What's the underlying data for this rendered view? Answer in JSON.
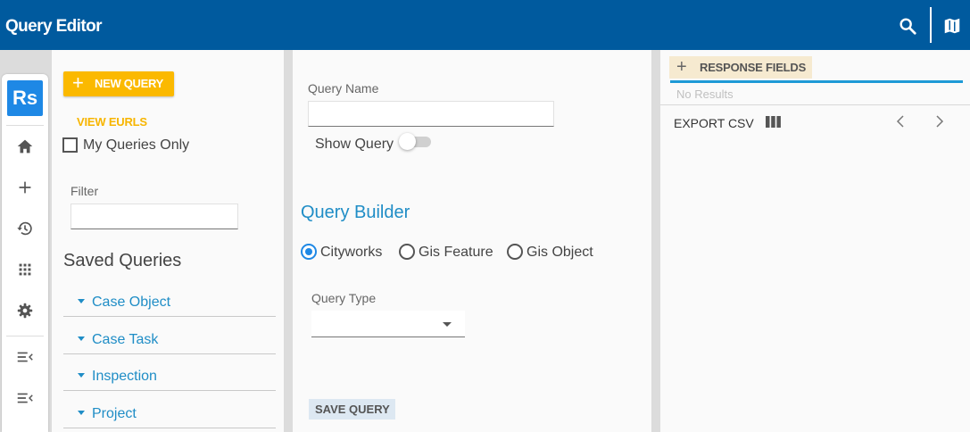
{
  "header": {
    "title": "Query Editor",
    "search_icon": "search-icon",
    "map_icon": "map-icon"
  },
  "rail": {
    "logo": "Rs",
    "items": [
      {
        "icon": "home-icon"
      },
      {
        "icon": "plus-icon"
      },
      {
        "icon": "history-icon"
      },
      {
        "icon": "apps-grid-icon"
      },
      {
        "icon": "gear-icon"
      },
      {
        "icon": "collapse-menu-icon"
      },
      {
        "icon": "collapse-menu-icon"
      }
    ]
  },
  "left_panel": {
    "new_query_label": "NEW QUERY",
    "view_eurls_label": "VIEW EURLS",
    "my_queries_label": "My Queries Only",
    "my_queries_checked": false,
    "filter_label": "Filter",
    "filter_value": "",
    "saved_queries_title": "Saved Queries",
    "groups": [
      {
        "label": "Case Object"
      },
      {
        "label": "Case Task"
      },
      {
        "label": "Inspection"
      },
      {
        "label": "Project"
      }
    ]
  },
  "middle_panel": {
    "query_name_label": "Query Name",
    "query_name_value": "",
    "show_query_label": "Show Query",
    "show_query_on": false,
    "builder_title": "Query Builder",
    "radio_options": [
      {
        "label": "Cityworks",
        "selected": true
      },
      {
        "label": "Gis Feature",
        "selected": false
      },
      {
        "label": "Gis Object",
        "selected": false
      }
    ],
    "query_type_label": "Query Type",
    "query_type_value": "",
    "save_query_label": "SAVE QUERY"
  },
  "right_panel": {
    "response_fields_label": "RESPONSE FIELDS",
    "no_results_text": "No Results",
    "export_csv_label": "EXPORT CSV",
    "columns_icon": "columns-icon",
    "prev_icon": "chevron-left-icon",
    "next_icon": "chevron-right-icon"
  },
  "colors": {
    "header_bg": "#005a9e",
    "accent_yellow": "#fbb900",
    "link_blue": "#1f8dc6",
    "radio_blue": "#1e88e5"
  }
}
